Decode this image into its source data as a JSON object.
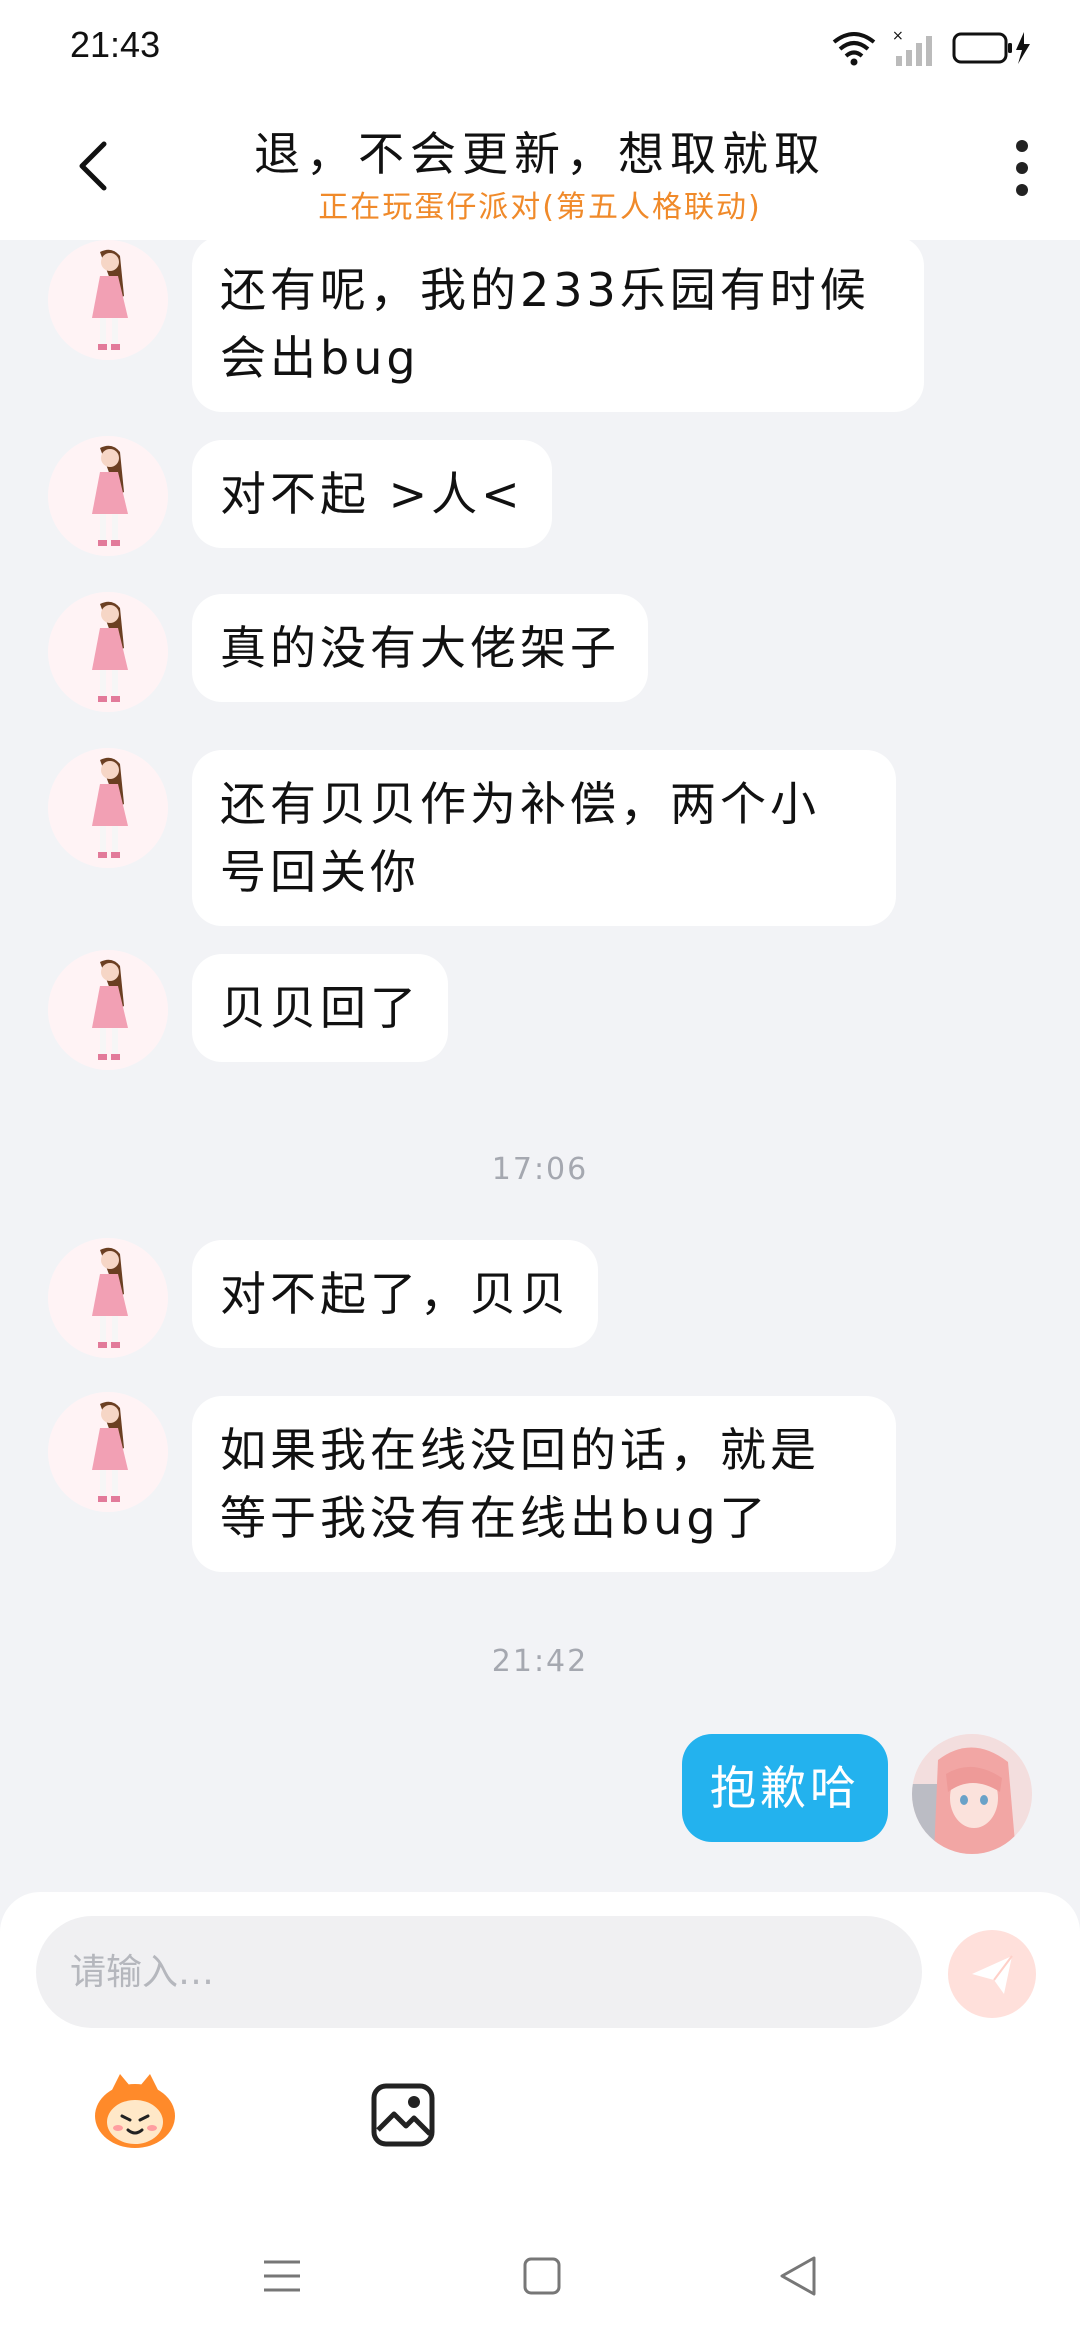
{
  "status_bar": {
    "time": "21:43"
  },
  "header": {
    "title": "退，不会更新，想取就取",
    "subtitle": "正在玩蛋仔派对(第五人格联动)"
  },
  "messages": [
    {
      "text": "还有呢，我的233乐园有时候会出bug"
    },
    {
      "text": "对不起 >人<"
    },
    {
      "text": "真的没有大佬架子"
    },
    {
      "text": "还有贝贝作为补偿，两个小号回关你"
    },
    {
      "text": "贝贝回了"
    },
    {
      "time": "17:06"
    },
    {
      "text": "对不起了，贝贝"
    },
    {
      "text": "如果我在线没回的话，就是等于我没有在线出bug了"
    },
    {
      "time": "21:42"
    },
    {
      "text": "抱歉哈"
    }
  ],
  "input": {
    "placeholder": "请输入…"
  },
  "colors": {
    "accent": "#23b2ee",
    "subtitle": "#f08a2a",
    "send_button": "#ffe0db"
  },
  "icons": {
    "back": "chevron-left-icon",
    "more": "more-vertical-icon",
    "send": "paper-plane-icon",
    "emoji": "mascot-emoji-icon",
    "image": "image-icon"
  }
}
